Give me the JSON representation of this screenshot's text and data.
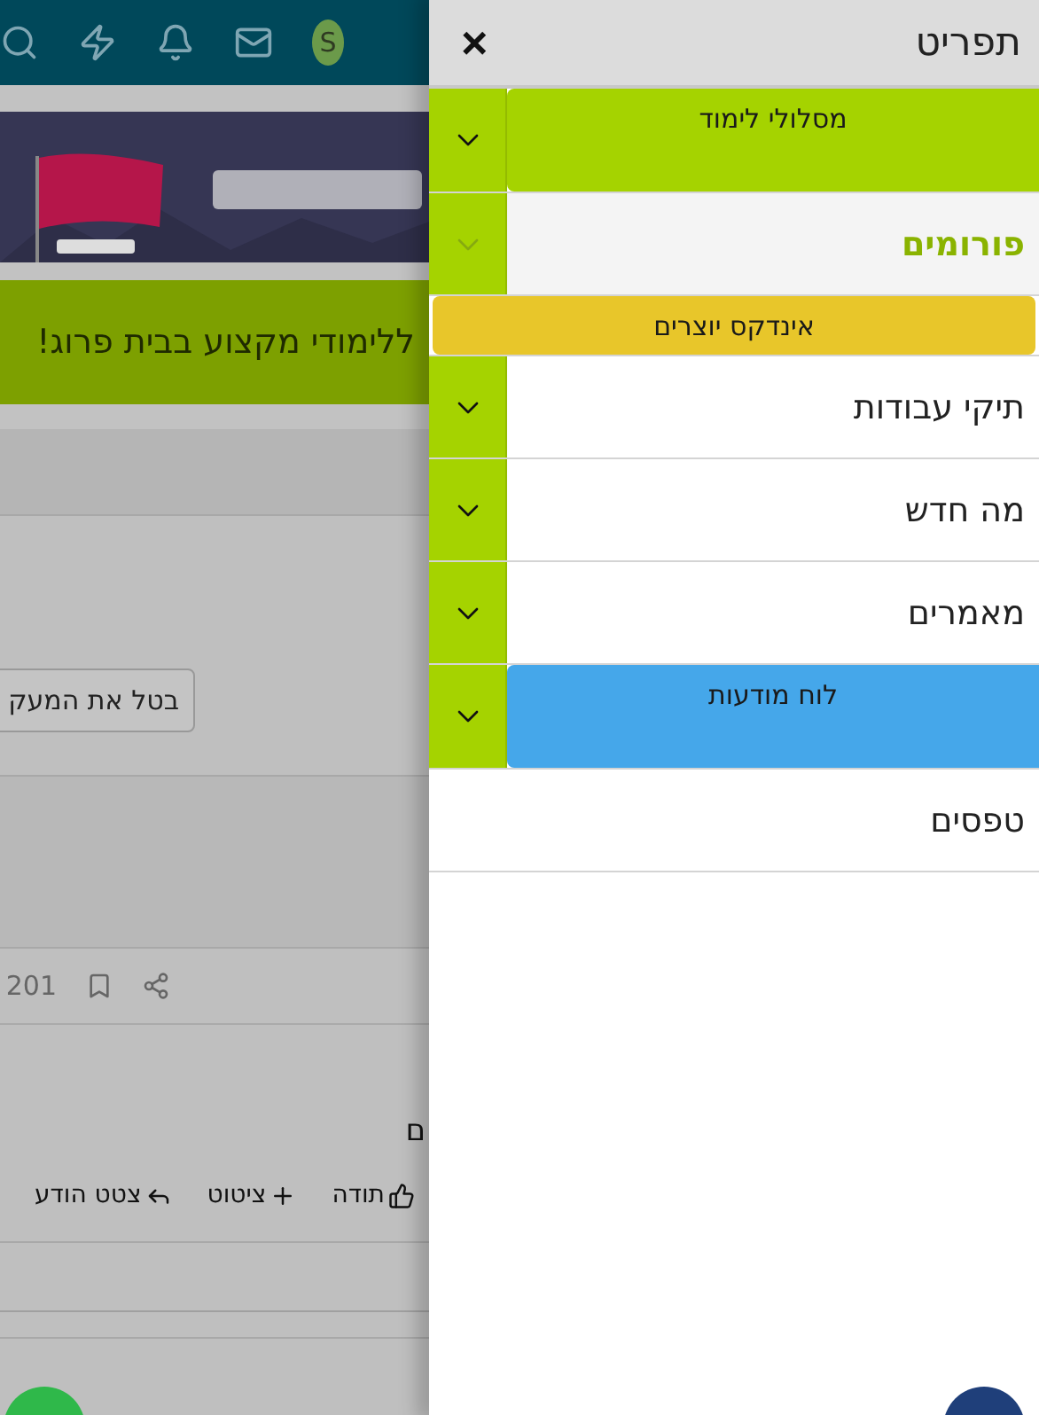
{
  "page": {
    "header": {
      "avatar": "S"
    },
    "notice": "ללימודי מקצוע בבית פרוג!",
    "unfollow_button": "בטל את המעק",
    "post_count": "201",
    "post_text": "ם",
    "actions": [
      {
        "kind": "like",
        "label": "תודה"
      },
      {
        "kind": "quote",
        "label": "ציטוט"
      },
      {
        "kind": "reply",
        "label": "צטט הודע"
      }
    ]
  },
  "menu": {
    "title": "תפריט",
    "close": "×",
    "items": [
      {
        "label": "מסלולי לימוד",
        "kind": "banner",
        "color": "#a5d300",
        "expandable": true,
        "selected": false
      },
      {
        "label": "פורומים",
        "kind": "plain",
        "expandable": true,
        "selected": true
      },
      {
        "label": "אינדקס יוצרים",
        "kind": "strip",
        "color": "#e8c62a",
        "expandable": false,
        "selected": false
      },
      {
        "label": "תיקי עבודות",
        "kind": "plain",
        "expandable": true,
        "selected": false
      },
      {
        "label": "מה חדש",
        "kind": "plain",
        "expandable": true,
        "selected": false
      },
      {
        "label": "מאמרים",
        "kind": "plain",
        "expandable": true,
        "selected": false
      },
      {
        "label": "לוח מודעות",
        "kind": "banner",
        "color": "#45a7ea",
        "expandable": true,
        "selected": false
      },
      {
        "label": "טפסים",
        "kind": "plain",
        "expandable": false,
        "selected": false
      }
    ]
  }
}
